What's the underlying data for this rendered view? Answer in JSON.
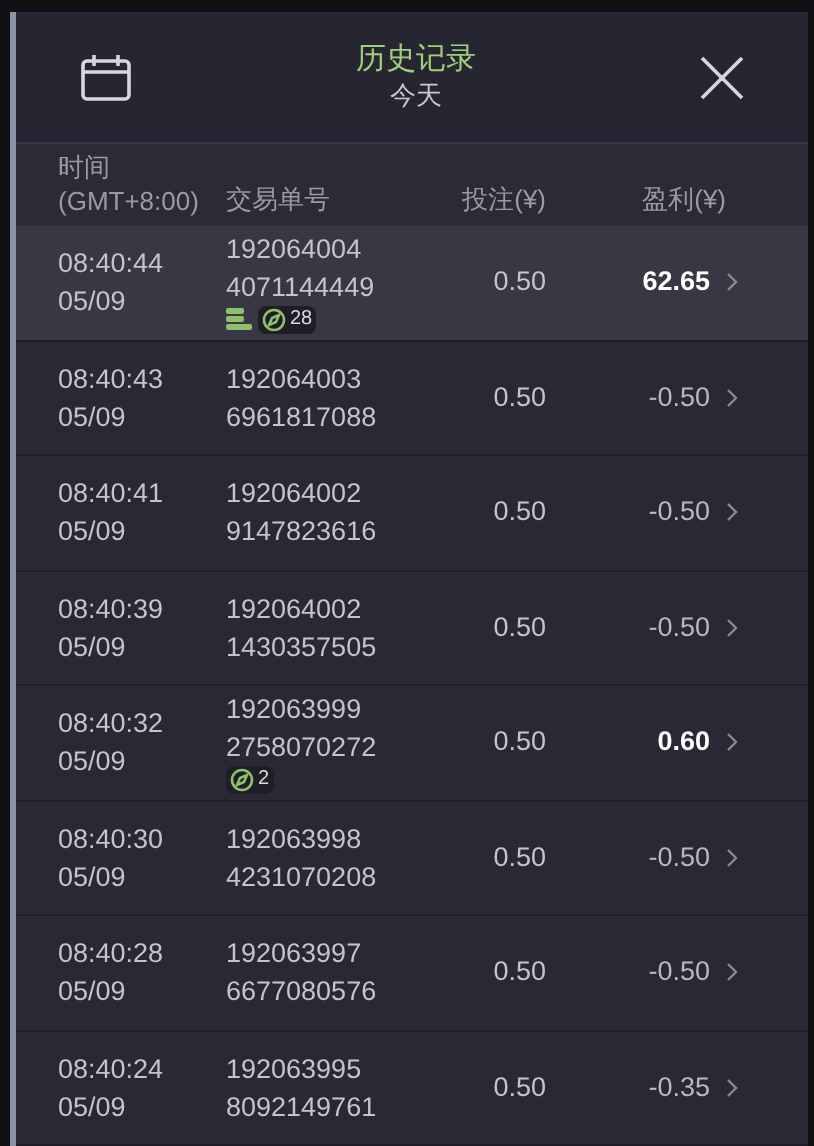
{
  "header": {
    "title": "历史记录",
    "subtitle": "今天"
  },
  "columns": [
    "时间\n(GMT+8:00)",
    "交易单号",
    "投注(¥)",
    "盈利(¥)"
  ],
  "rows": [
    {
      "time": "08:40:44",
      "date": "05/09",
      "ticket": [
        "192064004",
        "4071144449"
      ],
      "coins": true,
      "badge": "28",
      "stake": "0.50",
      "profit": "62.65",
      "kind": "win",
      "selected": true
    },
    {
      "time": "08:40:43",
      "date": "05/09",
      "ticket": [
        "192064003",
        "6961817088"
      ],
      "coins": false,
      "stake": "0.50",
      "profit": "-0.50",
      "kind": "loss",
      "selected": false
    },
    {
      "time": "08:40:41",
      "date": "05/09",
      "ticket": [
        "192064002",
        "9147823616"
      ],
      "coins": false,
      "stake": "0.50",
      "profit": "-0.50",
      "kind": "loss",
      "selected": false
    },
    {
      "time": "08:40:39",
      "date": "05/09",
      "ticket": [
        "192064002",
        "1430357505"
      ],
      "coins": false,
      "stake": "0.50",
      "profit": "-0.50",
      "kind": "loss",
      "selected": false
    },
    {
      "time": "08:40:32",
      "date": "05/09",
      "ticket": [
        "192063999",
        "2758070272"
      ],
      "coins": false,
      "badge": "2",
      "stake": "0.50",
      "profit": "0.60",
      "kind": "win",
      "selected": false
    },
    {
      "time": "08:40:30",
      "date": "05/09",
      "ticket": [
        "192063998",
        "4231070208"
      ],
      "coins": false,
      "stake": "0.50",
      "profit": "-0.50",
      "kind": "loss",
      "selected": false
    },
    {
      "time": "08:40:28",
      "date": "05/09",
      "ticket": [
        "192063997",
        "6677080576"
      ],
      "coins": false,
      "stake": "0.50",
      "profit": "-0.50",
      "kind": "loss",
      "selected": false
    },
    {
      "time": "08:40:24",
      "date": "05/09",
      "ticket": [
        "192063995",
        "8092149761"
      ],
      "coins": false,
      "stake": "0.50",
      "profit": "-0.35",
      "kind": "loss",
      "selected": false
    }
  ]
}
